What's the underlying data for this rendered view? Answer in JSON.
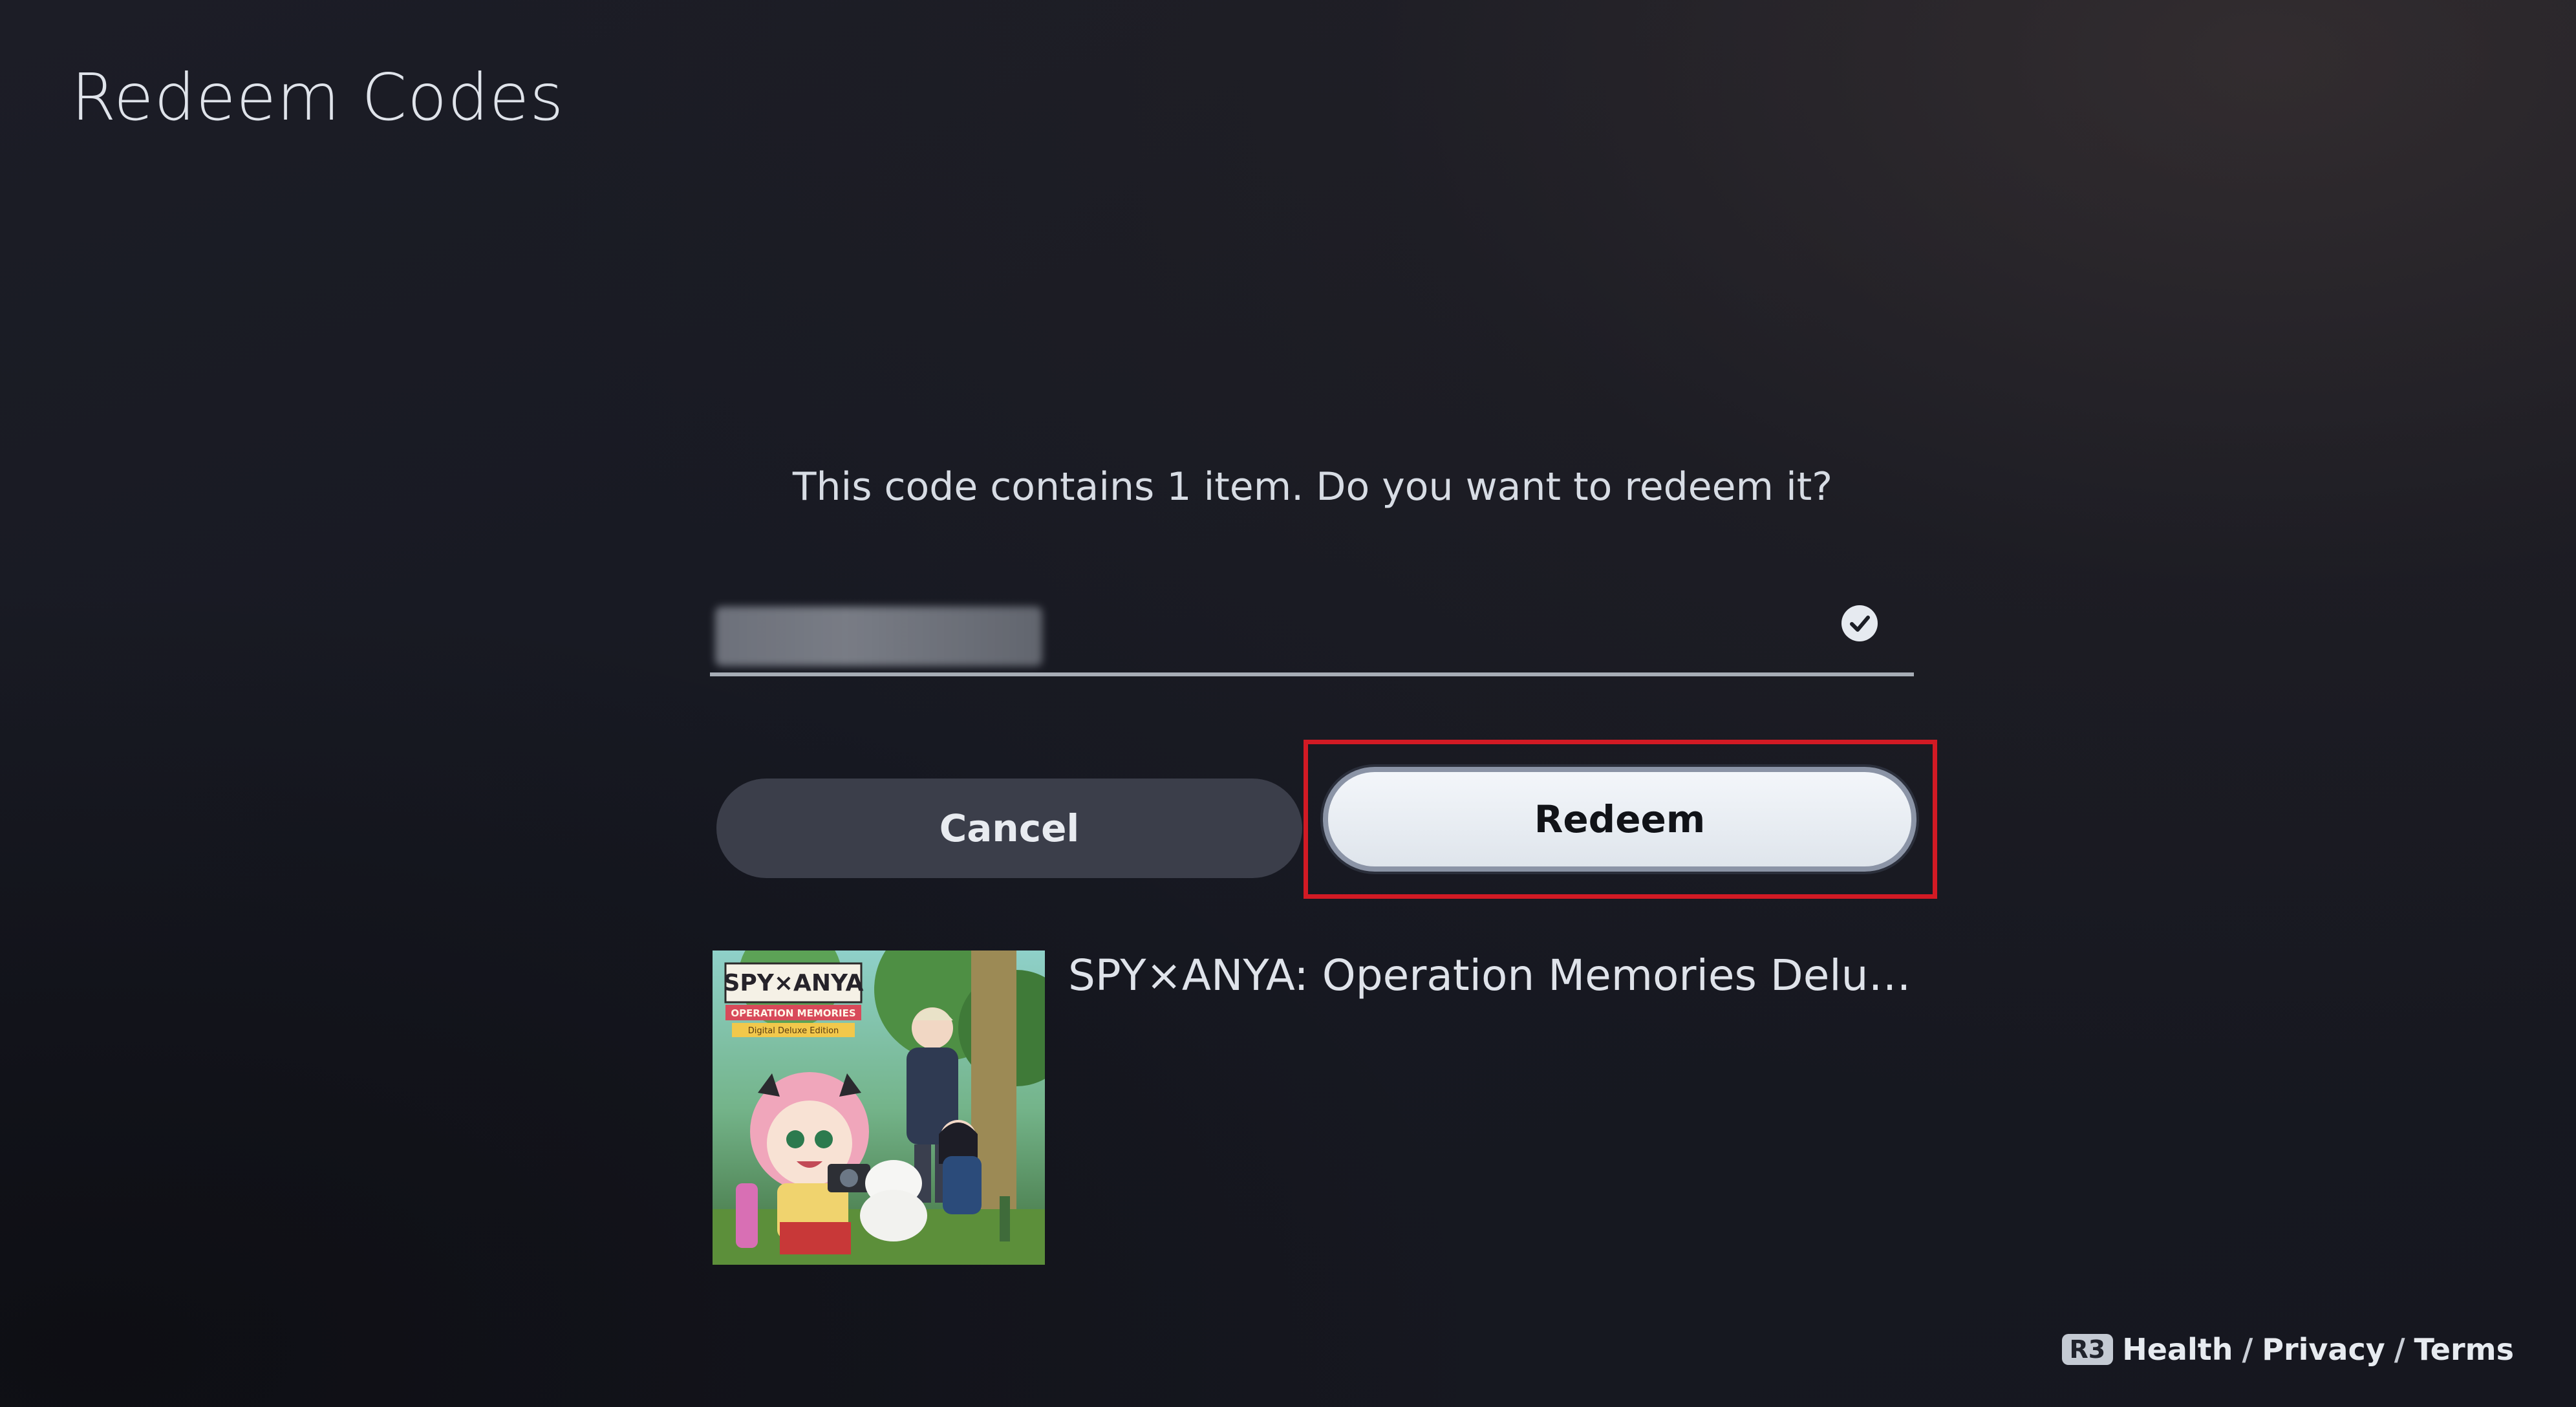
{
  "page": {
    "title": "Redeem Codes"
  },
  "dialog": {
    "prompt": "This code contains 1 item. Do you want to redeem it?",
    "code_field": {
      "value_blurred": true,
      "valid_icon": "check-circle-icon"
    },
    "buttons": {
      "cancel_label": "Cancel",
      "redeem_label": "Redeem"
    },
    "highlighted_control": "redeem-button",
    "highlight_color": "#d21a24"
  },
  "item": {
    "name": "SPY×ANYA: Operation Memories Delu…",
    "art": {
      "title_line1": "SPY×ANYA",
      "title_line2": "OPERATION MEMORIES",
      "edition": "Digital Deluxe Edition"
    }
  },
  "footer": {
    "badge": "R3",
    "links": [
      "Health",
      "Privacy",
      "Terms"
    ],
    "separator": "/"
  },
  "colors": {
    "background": "#17181f",
    "focused_button": "#eef2f6",
    "secondary_button": "#3b3e4a"
  }
}
